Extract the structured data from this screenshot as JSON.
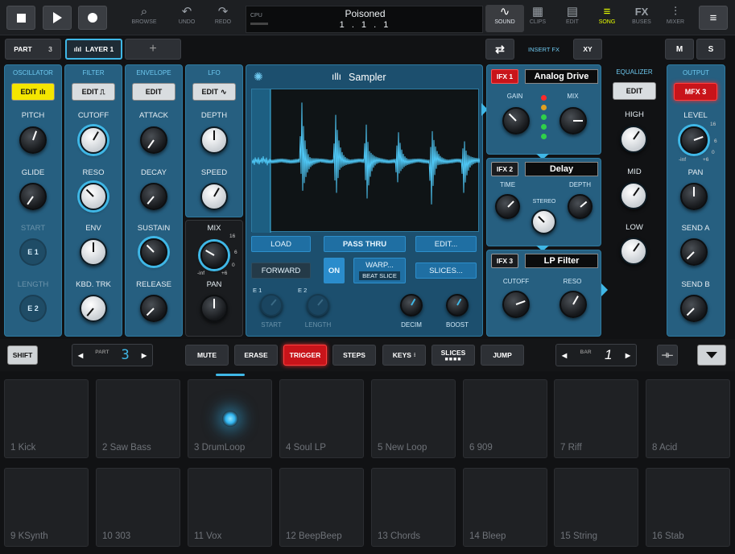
{
  "toolbar": {
    "browse": "BROWSE",
    "undo": "UNDO",
    "redo": "REDO",
    "cpu": "CPU",
    "song_name": "Poisoned",
    "position": "1 . 1 . 1",
    "sound": "SOUND",
    "clips": "CLIPS",
    "edit": "EDIT",
    "song": "SONG",
    "fx_glyph": "FX",
    "buses": "BUSES",
    "mixer": "MIXER"
  },
  "row2": {
    "part": "PART",
    "part_num": "3",
    "layer": "LAYER 1",
    "add": "+",
    "insert_fx": "INSERT FX",
    "xy": "XY",
    "m": "M",
    "s": "S"
  },
  "osc": {
    "title": "OSCILLATOR",
    "edit": "EDIT",
    "pitch": "PITCH",
    "glide": "GLIDE",
    "start": "START",
    "length": "LENGTH",
    "e1": "E 1",
    "e2": "E 2"
  },
  "filter": {
    "title": "FILTER",
    "edit": "EDIT",
    "cutoff": "CUTOFF",
    "reso": "RESO",
    "env": "ENV",
    "kbd": "KBD. TRK"
  },
  "envelope": {
    "title": "ENVELOPE",
    "edit": "EDIT",
    "attack": "ATTACK",
    "decay": "DECAY",
    "sustain": "SUSTAIN",
    "release": "RELEASE"
  },
  "lfo": {
    "title": "LFO",
    "edit": "EDIT",
    "depth": "DEPTH",
    "speed": "SPEED",
    "mix": "MIX",
    "pan": "PAN",
    "scale": [
      "16",
      "6",
      "0",
      "-inf",
      "+6"
    ]
  },
  "sampler": {
    "title": "Sampler",
    "load": "LOAD",
    "passthru": "PASS THRU",
    "edit": "EDIT...",
    "forward": "FORWARD",
    "on": "ON",
    "warp": "WARP...",
    "beatslice": "BEAT SLICE",
    "slices": "SLICES...",
    "e1": "E 1",
    "e2": "E 2",
    "start": "START",
    "length": "LENGTH",
    "decim": "DECIM",
    "boost": "BOOST"
  },
  "ifx1": {
    "tag": "IFX 1",
    "name": "Analog Drive",
    "gain": "GAIN",
    "mix": "MIX"
  },
  "ifx2": {
    "tag": "IFX 2",
    "name": "Delay",
    "time": "TIME",
    "depth": "DEPTH",
    "stereo": "STEREO"
  },
  "ifx3": {
    "tag": "IFX 3",
    "name": "LP Filter",
    "cutoff": "CUTOFF",
    "reso": "RESO"
  },
  "eq": {
    "title": "EQUALIZER",
    "edit": "EDIT",
    "high": "HIGH",
    "mid": "MID",
    "low": "LOW"
  },
  "output": {
    "title": "OUTPUT",
    "mfx": "MFX 3",
    "level": "LEVEL",
    "pan": "PAN",
    "senda": "SEND A",
    "sendb": "SEND B",
    "scale": [
      "16",
      "6",
      "0",
      "-inf",
      "+6"
    ]
  },
  "bottombar": {
    "shift": "SHIFT",
    "part_label": "PART",
    "part_val": "3",
    "mute": "MUTE",
    "erase": "ERASE",
    "trigger": "TRIGGER",
    "steps": "STEPS",
    "keys": "KEYS",
    "slices": "SLICES",
    "jump": "JUMP",
    "bar_label": "BAR",
    "bar_val": "1"
  },
  "pads": [
    "1 Kick",
    "2 Saw Bass",
    "3 DrumLoop",
    "4 Soul LP",
    "5 New Loop",
    "6 909",
    "7 Riff",
    "8 Acid",
    "9 KSynth",
    "10 303",
    "11 Vox",
    "12 BeepBeep",
    "13 Chords",
    "14 Bleep",
    "15 String",
    "16 Stab"
  ],
  "colors": {
    "accent": "#3fb7e6",
    "panel": "#265f80",
    "red": "#c8141a",
    "yellow": "#f4e600"
  }
}
